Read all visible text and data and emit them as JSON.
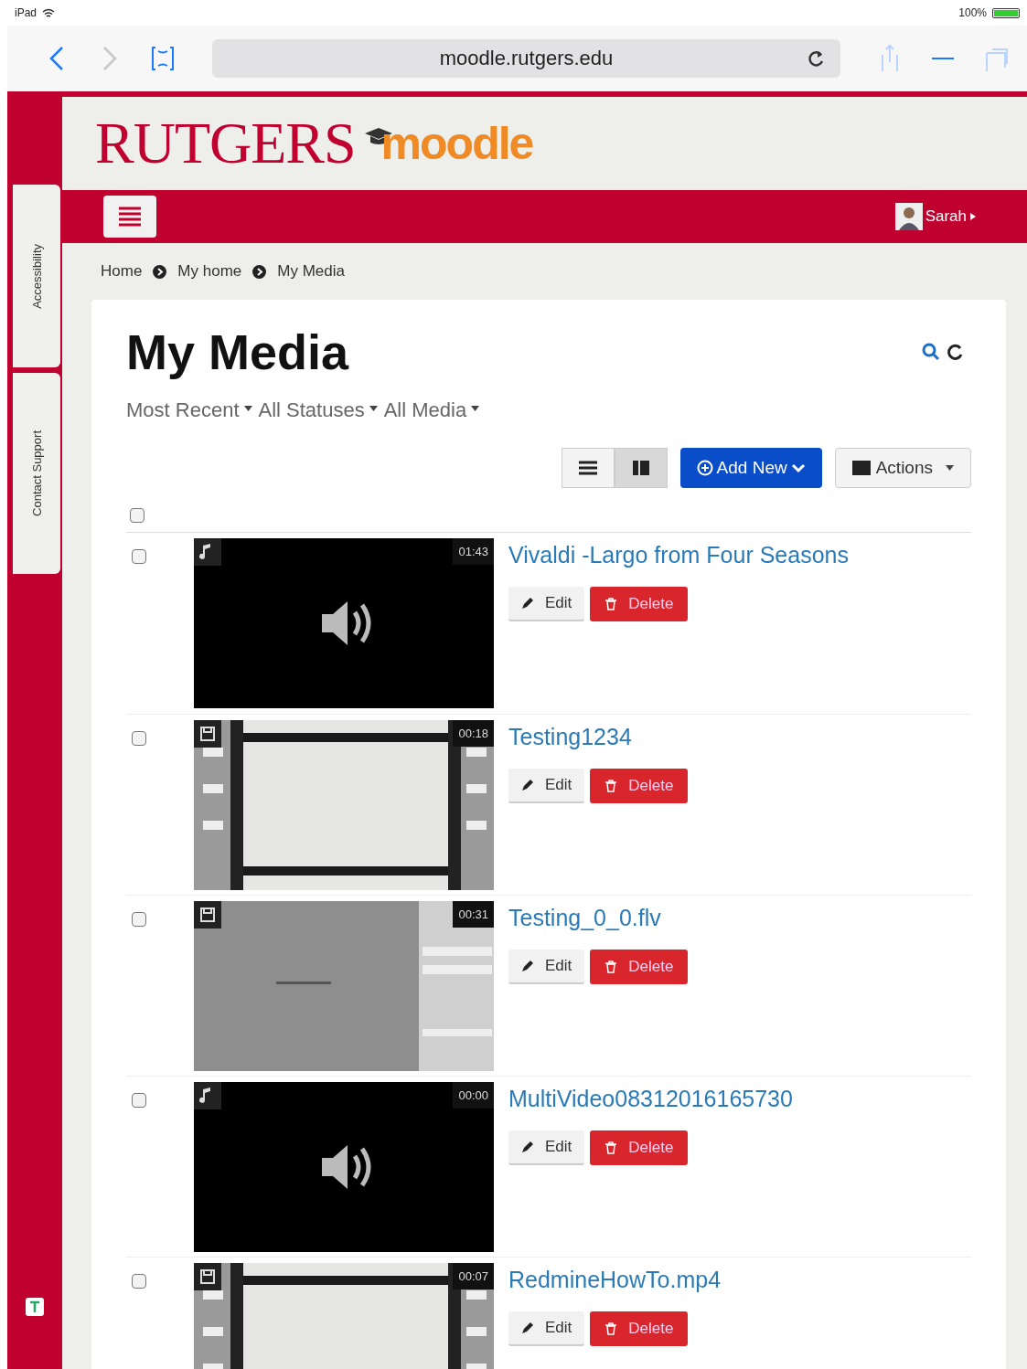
{
  "status_bar": {
    "device": "iPad",
    "battery": "100%"
  },
  "browser": {
    "address": "moodle.rutgers.edu"
  },
  "side_tabs": [
    "Accessibility",
    "Contact Support"
  ],
  "logo": {
    "brand": "RUTGERS",
    "product": "moodle"
  },
  "user_menu": {
    "name": "Sarah"
  },
  "breadcrumbs": [
    "Home",
    "My home",
    "My Media"
  ],
  "page_title": "My Media",
  "filters": [
    "Most Recent",
    "All Statuses",
    "All Media"
  ],
  "views": [
    {
      "kind": "list",
      "selected": false
    },
    {
      "kind": "grid",
      "selected": true
    }
  ],
  "add_button": "Add New",
  "actions_button": "Actions",
  "select_all": {
    "checked": false
  },
  "media": [
    {
      "title": "Vivaldi -Largo from Four Seasons",
      "duration": "01:43",
      "kind": "audio",
      "checked": false,
      "edit": "Edit",
      "delete": "Delete"
    },
    {
      "title": "Testing1234",
      "duration": "00:18",
      "kind": "video",
      "checked": false,
      "edit": "Edit",
      "delete": "Delete"
    },
    {
      "title": "Testing_0_0.flv",
      "duration": "00:31",
      "kind": "video",
      "checked": false,
      "edit": "Edit",
      "delete": "Delete"
    },
    {
      "title": "MultiVideo08312016165730",
      "duration": "00:00",
      "kind": "audio",
      "checked": false,
      "edit": "Edit",
      "delete": "Delete"
    },
    {
      "title": "RedmineHowTo.mp4",
      "duration": "00:07",
      "kind": "video",
      "checked": false,
      "edit": "Edit",
      "delete": "Delete"
    }
  ]
}
